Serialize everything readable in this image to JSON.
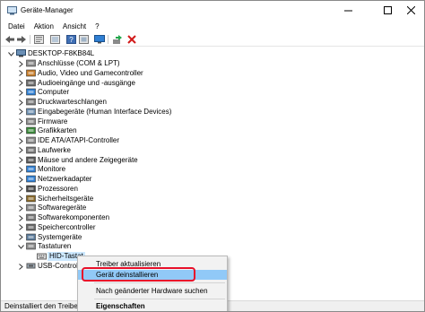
{
  "window": {
    "title": "Geräte-Manager"
  },
  "menu": [
    "Datei",
    "Aktion",
    "Ansicht",
    "?"
  ],
  "toolbar": {
    "buttons": [
      "back-icon",
      "forward-icon",
      "properties-icon",
      "show-hidden-icon",
      "help-icon",
      "scan-hardware-icon",
      "monitor-icon",
      "update-driver-icon",
      "uninstall-icon"
    ]
  },
  "tree": {
    "root": "DESKTOP-F8KB84L",
    "categories": [
      "Anschlüsse (COM & LPT)",
      "Audio, Video und Gamecontroller",
      "Audioeingänge und -ausgänge",
      "Computer",
      "Druckwarteschlangen",
      "Eingabegeräte (Human Interface Devices)",
      "Firmware",
      "Grafikkarten",
      "IDE ATA/ATAPI-Controller",
      "Laufwerke",
      "Mäuse und andere Zeigegeräte",
      "Monitore",
      "Netzwerkadapter",
      "Prozessoren",
      "Sicherheitsgeräte",
      "Softwaregeräte",
      "Softwarekomponenten",
      "Speichercontroller",
      "Systemgeräte",
      "Tastaturen"
    ],
    "child": "HID-Tastat",
    "last": "USB-Controlle"
  },
  "context_menu": {
    "items": [
      "Treiber aktualisieren",
      "Gerät deinstallieren",
      "Nach geänderter Hardware suchen",
      "Eigenschaften"
    ]
  },
  "status": {
    "text": "Deinstalliert den Treiber de"
  },
  "colors": {
    "highlight": "#91c9f7",
    "callout": "#e8102a",
    "selection": "#cce8ff"
  }
}
